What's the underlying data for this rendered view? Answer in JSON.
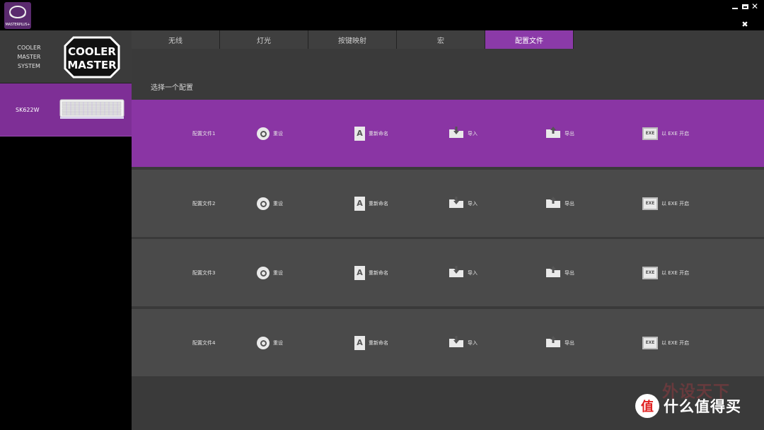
{
  "app": {
    "logo_text": "MASTERPLUS+"
  },
  "window_controls": {
    "minimize": "minimize-icon",
    "maximize": "maximize-icon",
    "close": "✕",
    "settings": "✖"
  },
  "sidebar": {
    "system": {
      "label": "COOLER MASTER SYSTEM",
      "logo": "COOLER MASTER"
    },
    "device": {
      "label": "SK622W"
    }
  },
  "tabs": [
    {
      "label": "无线"
    },
    {
      "label": "灯光"
    },
    {
      "label": "按键映射"
    },
    {
      "label": "宏"
    },
    {
      "label": "配置文件"
    }
  ],
  "active_tab": "配置文件",
  "section_title": "选择一个配置",
  "actions": {
    "reset": "重设",
    "rename": "重新命名",
    "import": "导入",
    "export": "导出",
    "exe": "以 EXE 开启",
    "exe_icon_text": "EXE",
    "rename_icon_text": "A"
  },
  "profiles": [
    {
      "name": "配置文件1",
      "active": true
    },
    {
      "name": "配置文件2",
      "active": false
    },
    {
      "name": "配置文件3",
      "active": false
    },
    {
      "name": "配置文件4",
      "active": false
    }
  ],
  "watermark": {
    "top": "外设天下",
    "badge": "值",
    "text": "什么值得买"
  },
  "colors": {
    "accent": "#8a35a4",
    "panel": "#4a4a4a",
    "background": "#3a3a3a"
  }
}
